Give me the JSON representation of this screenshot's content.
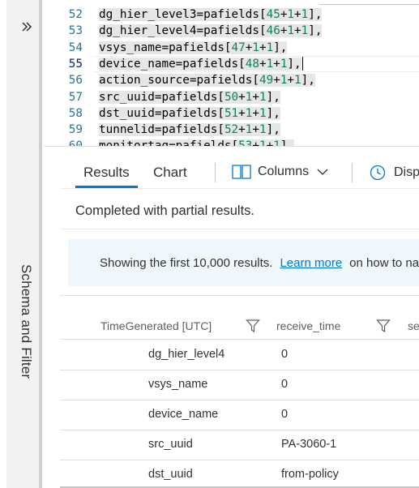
{
  "left_pane": {
    "vertical_label": "Schema and Filter",
    "expand_icon": "double-chevron-right-icon"
  },
  "editor": {
    "lines": [
      {
        "n": "52",
        "pre": "dg_hier_level3=pafields[",
        "a": "45",
        "mid": "+",
        "b": "1",
        "mid2": "+",
        "c": "1",
        "post": "],"
      },
      {
        "n": "53",
        "pre": "dg_hier_level4=pafields[",
        "a": "46",
        "mid": "+",
        "b": "1",
        "mid2": "+",
        "c": "1",
        "post": "],"
      },
      {
        "n": "54",
        "pre": "vsys_name=pafields[",
        "a": "47",
        "mid": "+",
        "b": "1",
        "mid2": "+",
        "c": "1",
        "post": "],"
      },
      {
        "n": "55",
        "pre": "device_name=pafields[",
        "a": "48",
        "mid": "+",
        "b": "1",
        "mid2": "+",
        "c": "1",
        "post": "],"
      },
      {
        "n": "56",
        "pre": "action_source=pafields[",
        "a": "49",
        "mid": "+",
        "b": "1",
        "mid2": "+",
        "c": "1",
        "post": "],"
      },
      {
        "n": "57",
        "pre": "src_uuid=pafields[",
        "a": "50",
        "mid": "+",
        "b": "1",
        "mid2": "+",
        "c": "1",
        "post": "],"
      },
      {
        "n": "58",
        "pre": "dst_uuid=pafields[",
        "a": "51",
        "mid": "+",
        "b": "1",
        "mid2": "+",
        "c": "1",
        "post": "],"
      },
      {
        "n": "59",
        "pre": "tunnelid=pafields[",
        "a": "52",
        "mid": "+",
        "b": "1",
        "mid2": "+",
        "c": "1",
        "post": "],"
      },
      {
        "n": "60",
        "pre": "monitortag=pafields[",
        "a": "53",
        "mid": "+",
        "b": "1",
        "mid2": "+",
        "c": "1",
        "post": "],"
      }
    ]
  },
  "results": {
    "tabs": {
      "results": "Results",
      "chart": "Chart"
    },
    "toolbar": {
      "columns": "Columns",
      "display": "Display"
    },
    "status": "Completed with partial results.",
    "info": {
      "message": "Showing the first 10,000 results.",
      "link": "Learn more",
      "tail": "on how to narrow down the results"
    },
    "grid": {
      "headers": [
        "TimeGenerated [UTC]",
        "receive_time",
        "se"
      ],
      "rows": [
        [
          "dg_hier_level4",
          "0"
        ],
        [
          "vsys_name",
          "0"
        ],
        [
          "device_name",
          "0"
        ],
        [
          "src_uuid",
          "PA-3060-1"
        ],
        [
          "dst_uuid",
          "from-policy"
        ]
      ]
    }
  },
  "colors": {
    "accent": "#0078d4",
    "line_number": "#237893",
    "number_literal": "#098658",
    "info_bg": "#eff6fc"
  }
}
